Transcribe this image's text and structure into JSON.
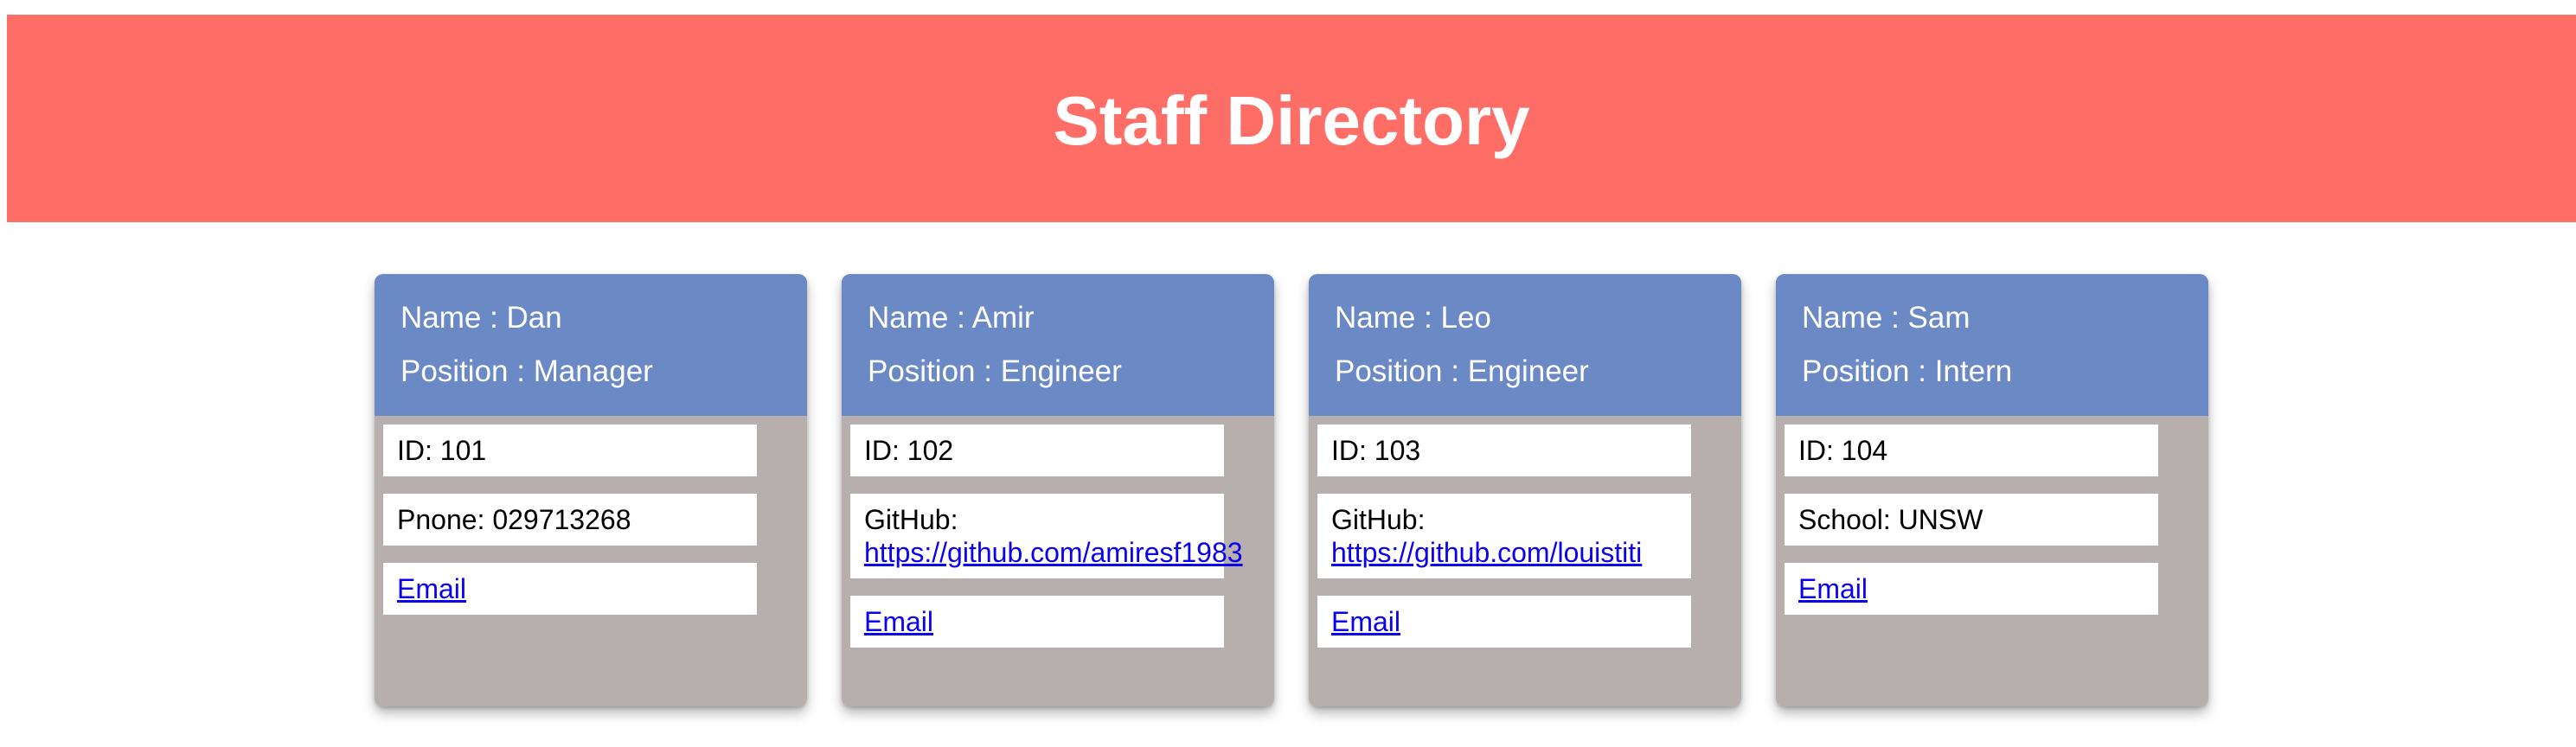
{
  "header": {
    "title": "Staff Directory",
    "background_color": "#ff6e66"
  },
  "colors": {
    "card_header": "#6b89c5",
    "card_body": "#b7aeae",
    "link": "#0b00ee"
  },
  "cards": [
    {
      "name": "Name : Dan",
      "position": "Position : Manager",
      "id": "ID: 101",
      "extra_label": "Pnone: 029713268",
      "email_label": "Email"
    },
    {
      "name": "Name : Amir",
      "position": "Position : Engineer",
      "id": "ID: 102",
      "extra_label": "GitHub:",
      "extra_link": "https://github.com/amiresf1983",
      "email_label": "Email"
    },
    {
      "name": "Name : Leo",
      "position": "Position : Engineer",
      "id": "ID: 103",
      "extra_label": "GitHub:",
      "extra_link": "https://github.com/louistiti",
      "email_label": "Email"
    },
    {
      "name": "Name : Sam",
      "position": "Position : Intern",
      "id": "ID: 104",
      "extra_label": "School: UNSW",
      "email_label": "Email"
    }
  ]
}
